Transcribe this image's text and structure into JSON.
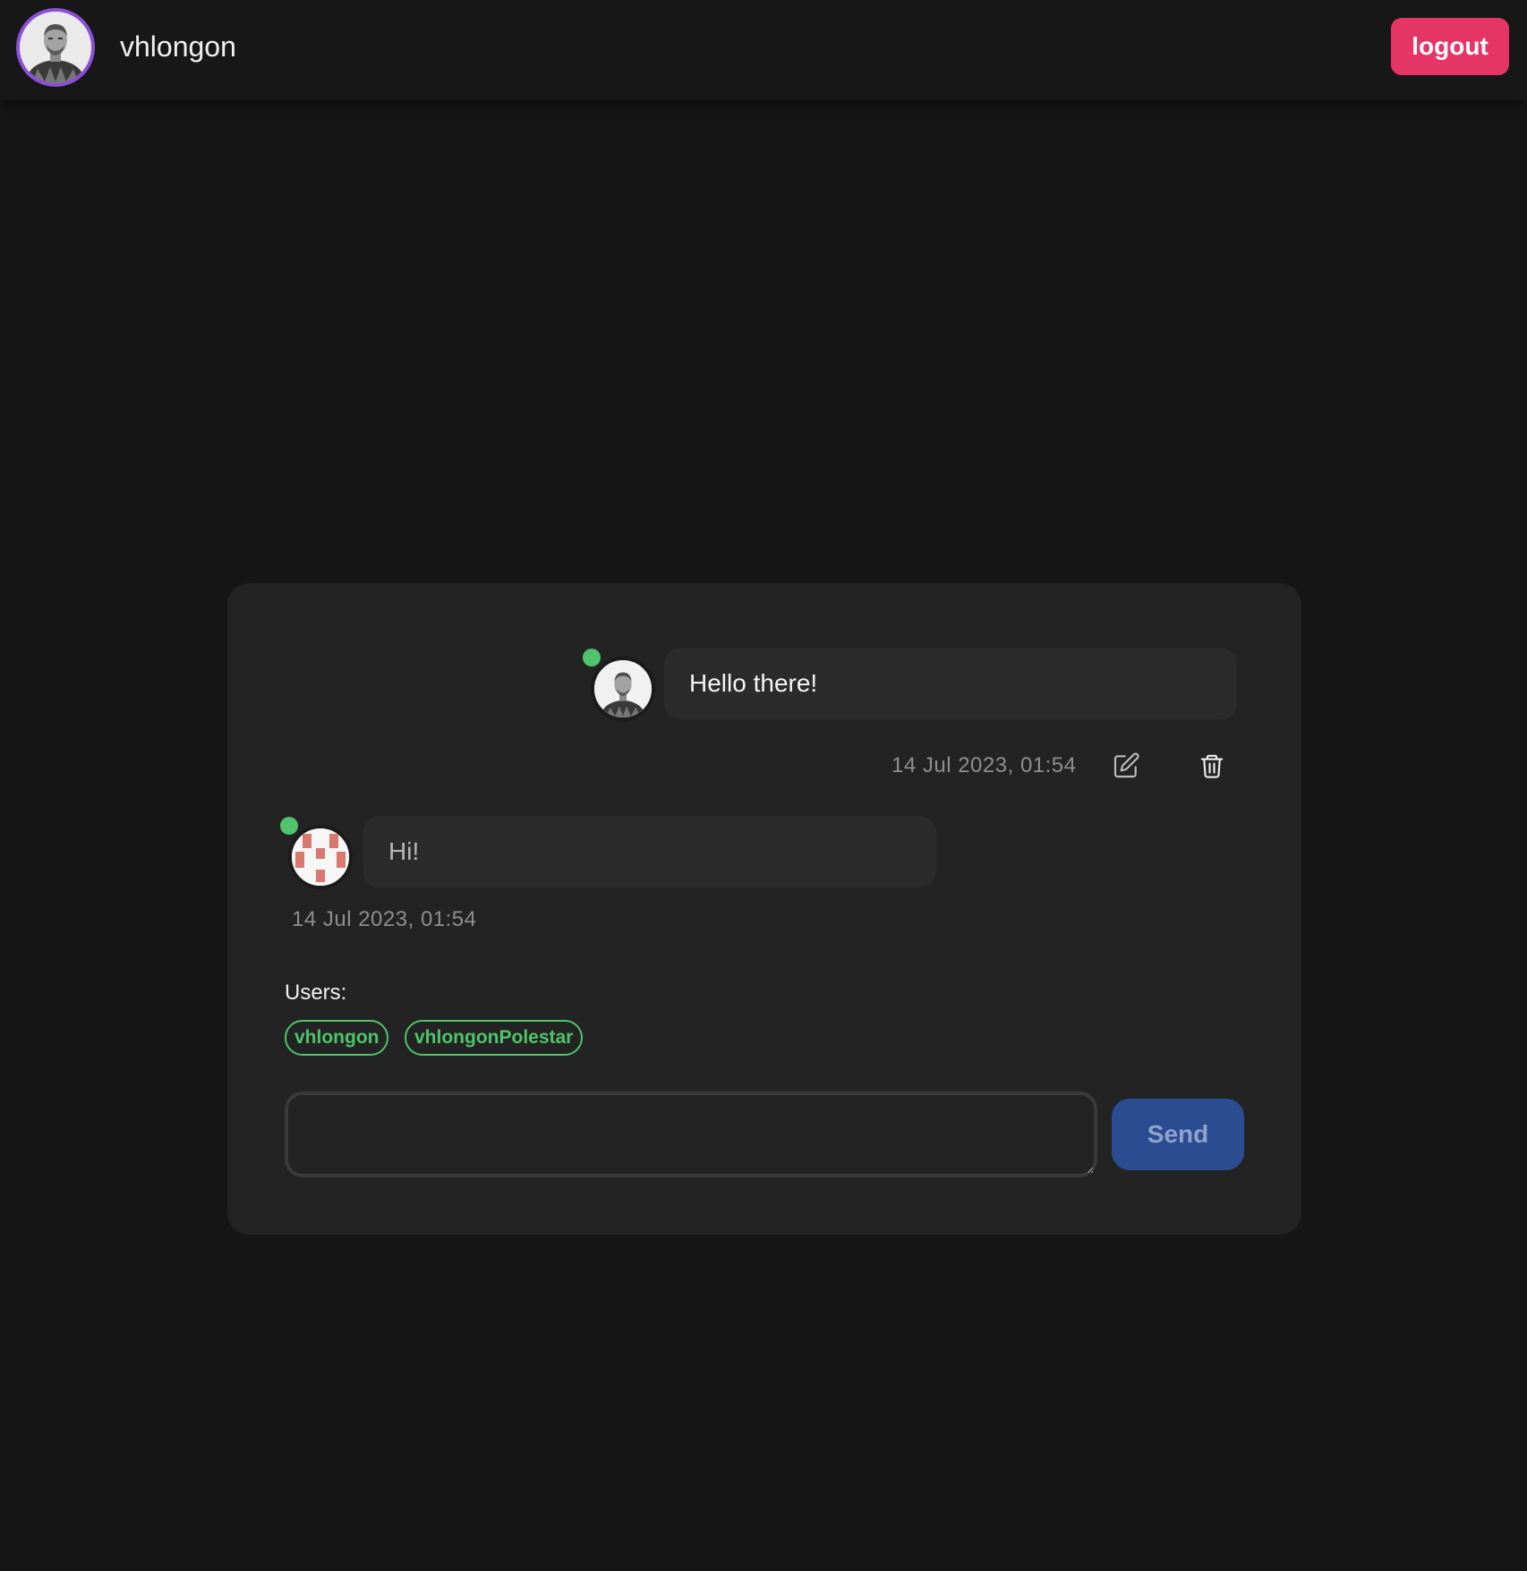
{
  "header": {
    "username": "vhlongon",
    "logout_label": "logout",
    "avatar_icon": "user-portrait-icon"
  },
  "chat": {
    "messages": [
      {
        "author": "vhlongon",
        "text": "Hello there!",
        "timestamp": "14 Jul 2023, 01:54",
        "online": true,
        "own": true,
        "avatar_icon": "user-portrait-icon",
        "actions": [
          "edit-icon",
          "trash-icon"
        ]
      },
      {
        "author": "vhlongonPolestar",
        "text": "Hi!",
        "timestamp": "14 Jul 2023, 01:54",
        "online": true,
        "own": false,
        "avatar_icon": "identicon-avatar-icon"
      }
    ],
    "users_label": "Users:",
    "users": [
      "vhlongon",
      "vhlongonPolestar"
    ],
    "input": {
      "value": "",
      "placeholder": ""
    },
    "send_label": "Send"
  },
  "colors": {
    "background": "#161616",
    "card": "#232323",
    "bubble": "#2b2b2b",
    "logout": "#e53566",
    "send": "#2b4c91",
    "online": "#4fc46a",
    "user_chip": "#4fc46a",
    "avatar_ring": "#8a4fd6",
    "identicon": "#d9786e"
  }
}
